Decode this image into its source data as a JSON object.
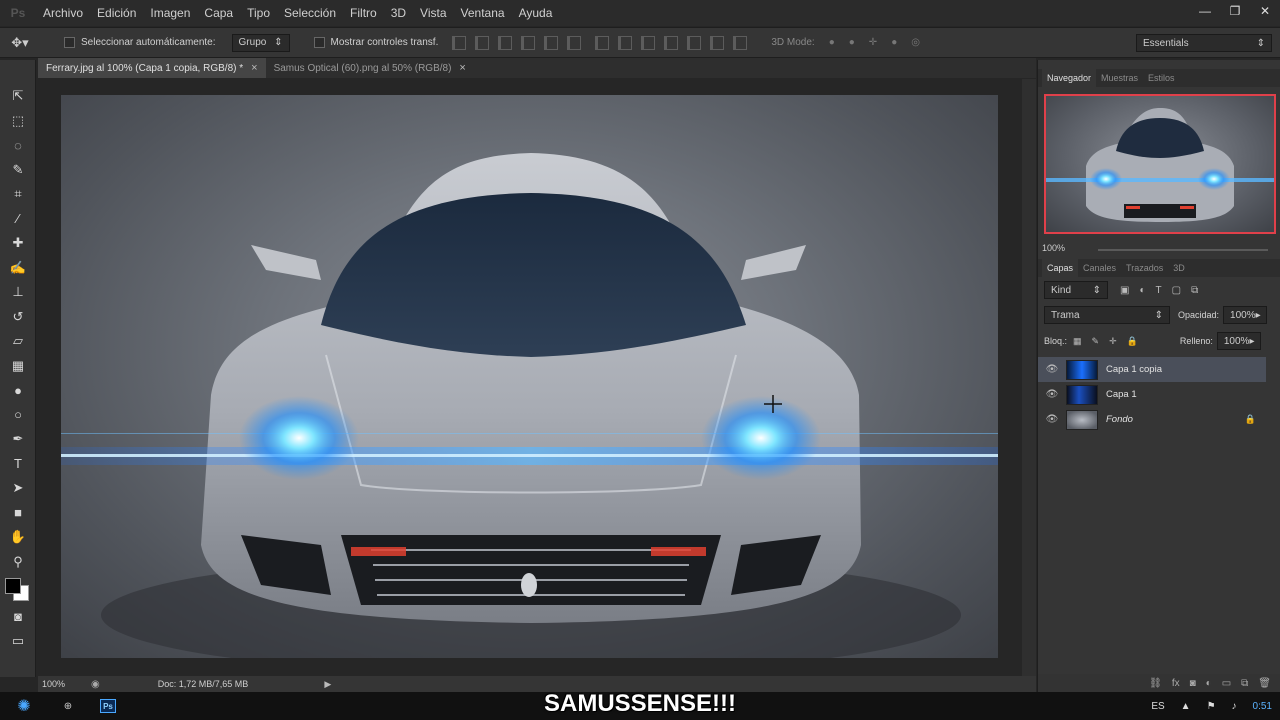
{
  "menu": [
    "Archivo",
    "Edición",
    "Imagen",
    "Capa",
    "Tipo",
    "Selección",
    "Filtro",
    "3D",
    "Vista",
    "Ventana",
    "Ayuda"
  ],
  "window_controls": {
    "minimize": "—",
    "restore": "❐",
    "close": "✕"
  },
  "options": {
    "auto_select_label": "Seleccionar automáticamente:",
    "auto_select_value": "Grupo",
    "show_transform_label": "Mostrar controles transf.",
    "mode_3d_label": "3D Mode:",
    "workspace": "Essentials"
  },
  "tabs": [
    {
      "label": "Ferrary.jpg al 100% (Capa 1 copia, RGB/8) *",
      "close": "×"
    },
    {
      "label": "Samus Optical (60).png al 50% (RGB/8)",
      "close": "×"
    }
  ],
  "status": {
    "zoom": "100%",
    "doc": "Doc: 1,72 MB/7,65 MB"
  },
  "navigator": {
    "tabs": [
      "Navegador",
      "Muestras",
      "Estilos"
    ],
    "zoom": "100%"
  },
  "layers_panel": {
    "tabs": [
      "Capas",
      "Canales",
      "Trazados",
      "3D"
    ],
    "kind": "Kind",
    "blend_mode": "Trama",
    "opacity_label": "Opacidad:",
    "opacity_value": "100%",
    "lock_label": "Bloq.:",
    "fill_label": "Relleno:",
    "fill_value": "100%",
    "layers": [
      {
        "name": "Capa 1 copia",
        "selected": true
      },
      {
        "name": "Capa 1",
        "selected": false
      },
      {
        "name": "Fondo",
        "selected": false,
        "locked": true
      }
    ]
  },
  "taskbar": {
    "app_badge": "Ps",
    "watermark": "SAMUSSENSE!!!",
    "lang": "ES",
    "clock": "0:51"
  }
}
